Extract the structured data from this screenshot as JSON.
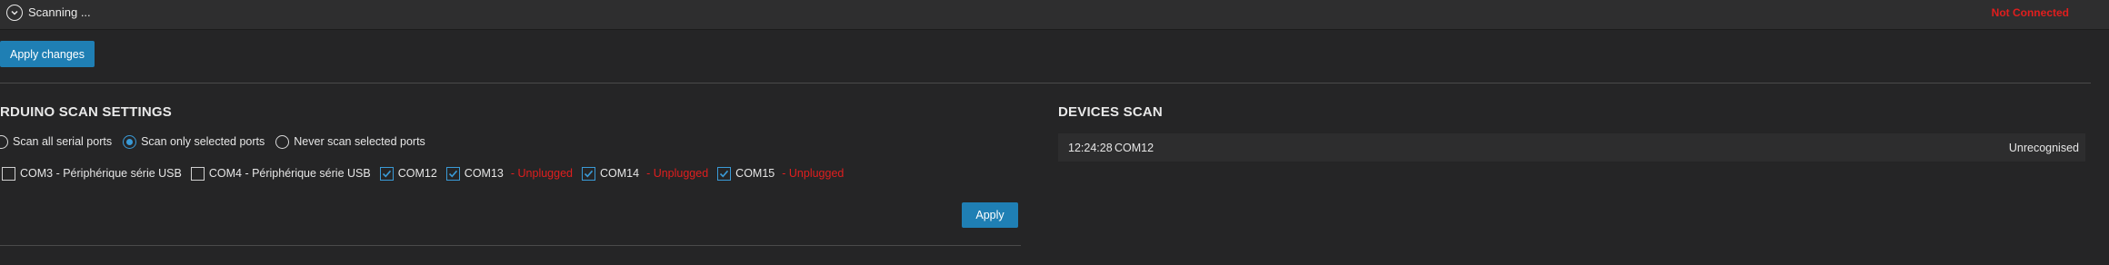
{
  "header": {
    "scan_label": "Scanning ...",
    "connection_status": "Not Connected"
  },
  "toolbar": {
    "apply_changes_label": "Apply changes"
  },
  "arduino_settings": {
    "title": "RDUINO SCAN SETTINGS",
    "scan_modes": [
      {
        "label": "Scan all serial ports",
        "selected": false
      },
      {
        "label": "Scan only selected ports",
        "selected": true
      },
      {
        "label": "Never scan selected ports",
        "selected": false
      }
    ],
    "ports": [
      {
        "label": "COM3 - Périphérique série USB",
        "checked": false,
        "status": ""
      },
      {
        "label": "COM4 - Périphérique série USB",
        "checked": false,
        "status": ""
      },
      {
        "label": "COM12",
        "checked": true,
        "status": ""
      },
      {
        "label": "COM13",
        "checked": true,
        "status": "- Unplugged"
      },
      {
        "label": "COM14",
        "checked": true,
        "status": "- Unplugged"
      },
      {
        "label": "COM15",
        "checked": true,
        "status": "- Unplugged"
      }
    ],
    "apply_label": "Apply"
  },
  "devices_scan": {
    "title": "DEVICES SCAN",
    "entries": [
      {
        "time": "12:24:28",
        "port": "COM12",
        "status": "Unrecognised"
      }
    ]
  },
  "colors": {
    "accent": "#1f7fb4",
    "error": "#e01e1e",
    "background": "#252526"
  },
  "icons": {
    "scan_toggle": "chevron-down-circle-icon",
    "checkbox_checked": "checkmark-icon"
  }
}
